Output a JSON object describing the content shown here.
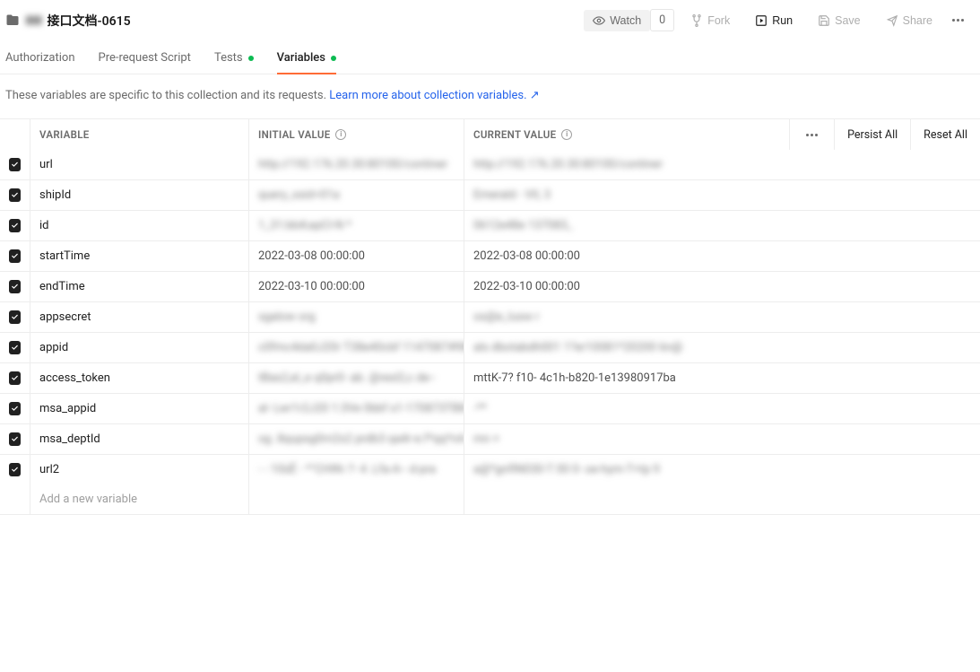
{
  "header": {
    "title_prefix": "▮▮▮",
    "title": "接口文档-0615",
    "watch_label": "Watch",
    "watch_count": "0",
    "fork_label": "Fork",
    "run_label": "Run",
    "save_label": "Save",
    "share_label": "Share"
  },
  "tabs": [
    {
      "label": "Authorization",
      "active": false,
      "dot": false
    },
    {
      "label": "Pre-request Script",
      "active": false,
      "dot": false
    },
    {
      "label": "Tests",
      "active": false,
      "dot": true
    },
    {
      "label": "Variables",
      "active": true,
      "dot": true
    }
  ],
  "description": {
    "text": "These variables are specific to this collection and its requests. ",
    "link_text": "Learn more about collection variables. ↗"
  },
  "table": {
    "columns": {
      "variable": "VARIABLE",
      "initial_value": "INITIAL VALUE",
      "current_value": "CURRENT VALUE"
    },
    "actions": {
      "persist_all": "Persist All",
      "reset_all": "Reset All"
    },
    "rows": [
      {
        "name": "url",
        "initial": "http://192.176.20.30:80100/continer",
        "current": "http://192.176.20.30:80100/continer",
        "blur_i": true,
        "blur_c": true
      },
      {
        "name": "shipId",
        "initial": "query_ssid=01a",
        "current": "Emerald - VII, 3",
        "blur_i": true,
        "blur_c": true
      },
      {
        "name": "id",
        "initial": "1_31:bb#,epCI-N *",
        "current": "0612e48e 137083_",
        "blur_i": true,
        "blur_c": true
      },
      {
        "name": "startTime",
        "initial": "2022-03-08 00:00:00",
        "current": "2022-03-08 00:00:00",
        "blur_i": false,
        "blur_c": false
      },
      {
        "name": "endTime",
        "initial": "2022-03-10 00:00:00",
        "current": "2022-03-10 00:00:00",
        "blur_i": false,
        "blur_c": false
      },
      {
        "name": "appsecret",
        "initial": "sgalow org",
        "current": "os@e_Iusw r",
        "blur_i": true,
        "blur_c": true
      },
      {
        "name": "appid",
        "initial": "c0fmc4da0J20r T38e40cbf 1147087#98u",
        "current": "als dbotabdh001 1?er10081*20200 6n@",
        "blur_i": true,
        "blur_c": true
      },
      {
        "name": "access_token",
        "initial": "tBas2,el_e q0pr0- ab. @resl2,c de--",
        "current": "mttK-7?  f10- 4c1h-b820-1e13980917ba",
        "blur_i": true,
        "blur_c": false
      },
      {
        "name": "msa_appid",
        "initial": "al- Lwr1r2J20 1:3Ve 0bbf s1-170873TB8",
        "current": "-**",
        "blur_i": true,
        "blur_c": true
      },
      {
        "name": "msa_deptId",
        "initial": "og .8qupsg0rn2s2 prdb3 qa4r-e.f*qq*nA.f",
        "current": "mn +",
        "blur_i": true,
        "blur_c": true
      },
      {
        "name": "url2",
        "initial": "- - 10üË - *°CHIN-:?- 4 .Lfa-A-- d-pra",
        "current": "a@*gnfIN030-T 00 0- oe-hym-T+tp 9",
        "blur_i": true,
        "blur_c": true
      }
    ],
    "add_placeholder": "Add a new variable"
  }
}
